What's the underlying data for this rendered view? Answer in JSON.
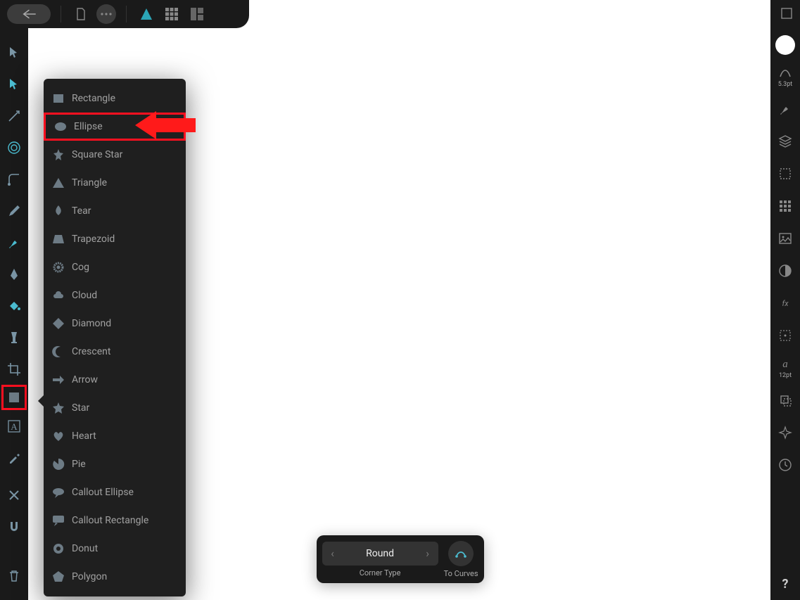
{
  "stroke_pt": "5.3pt",
  "typography_pt": "12pt",
  "shapes": [
    "Rectangle",
    "Ellipse",
    "Square Star",
    "Triangle",
    "Tear",
    "Trapezoid",
    "Cog",
    "Cloud",
    "Diamond",
    "Crescent",
    "Arrow",
    "Star",
    "Heart",
    "Pie",
    "Callout Ellipse",
    "Callout Rectangle",
    "Donut",
    "Polygon"
  ],
  "highlighted_shape_index": 1,
  "context": {
    "corner_type_value": "Round",
    "corner_type_label": "Corner Type",
    "to_curves_label": "To Curves"
  },
  "help_glyph": "?"
}
